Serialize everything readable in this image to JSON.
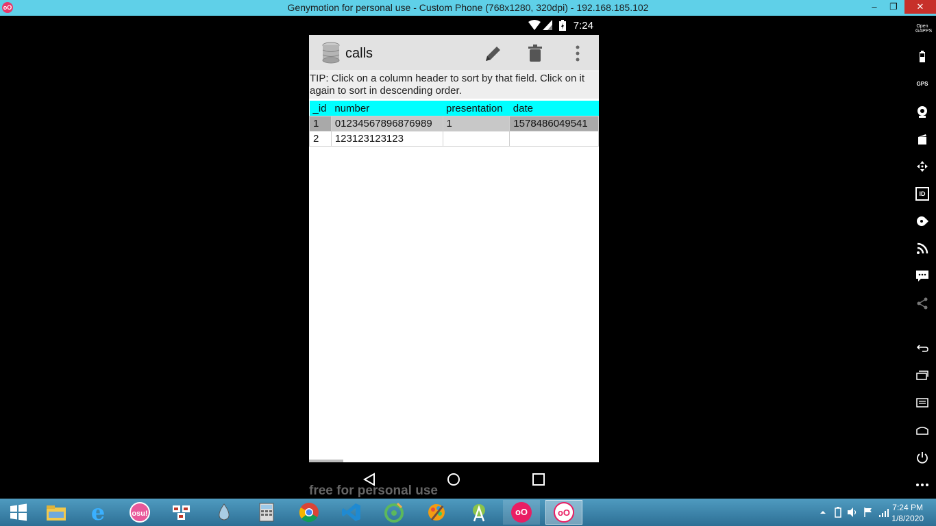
{
  "window": {
    "title": "Genymotion for personal use - Custom Phone (768x1280, 320dpi) - 192.168.185.102",
    "minimize": "–",
    "restore": "❐",
    "close": "✕"
  },
  "status_bar": {
    "time": "7:24"
  },
  "app": {
    "title": "calls",
    "tip": "TIP: Click on a column header to sort by that field. Click on it again to sort in descending order.",
    "columns": [
      "_id",
      "number",
      "presentation",
      "date"
    ],
    "rows": [
      [
        "1",
        "01234567896876989",
        "1",
        "1578486049541"
      ],
      [
        "2",
        "123123123123",
        "",
        ""
      ]
    ],
    "selected_row": 0
  },
  "watermark": "free for personal use",
  "sidebar": {
    "items": [
      "open-gapps-icon",
      "battery-icon",
      "gps-icon",
      "camera-icon",
      "capture-icon",
      "dpad-icon",
      "device-id-icon",
      "media-icon",
      "network-icon",
      "sms-icon",
      "share-icon",
      "back-icon",
      "recent-apps-icon",
      "menu-icon",
      "home-icon",
      "power-icon",
      "more-icon"
    ],
    "gapps_label": "Open GAPPS",
    "gps_label": "GPS",
    "id_label": "ID"
  },
  "taskbar": {
    "osu_label": "osu!",
    "clock_time": "7:24 PM",
    "clock_date": "1/8/2020"
  }
}
